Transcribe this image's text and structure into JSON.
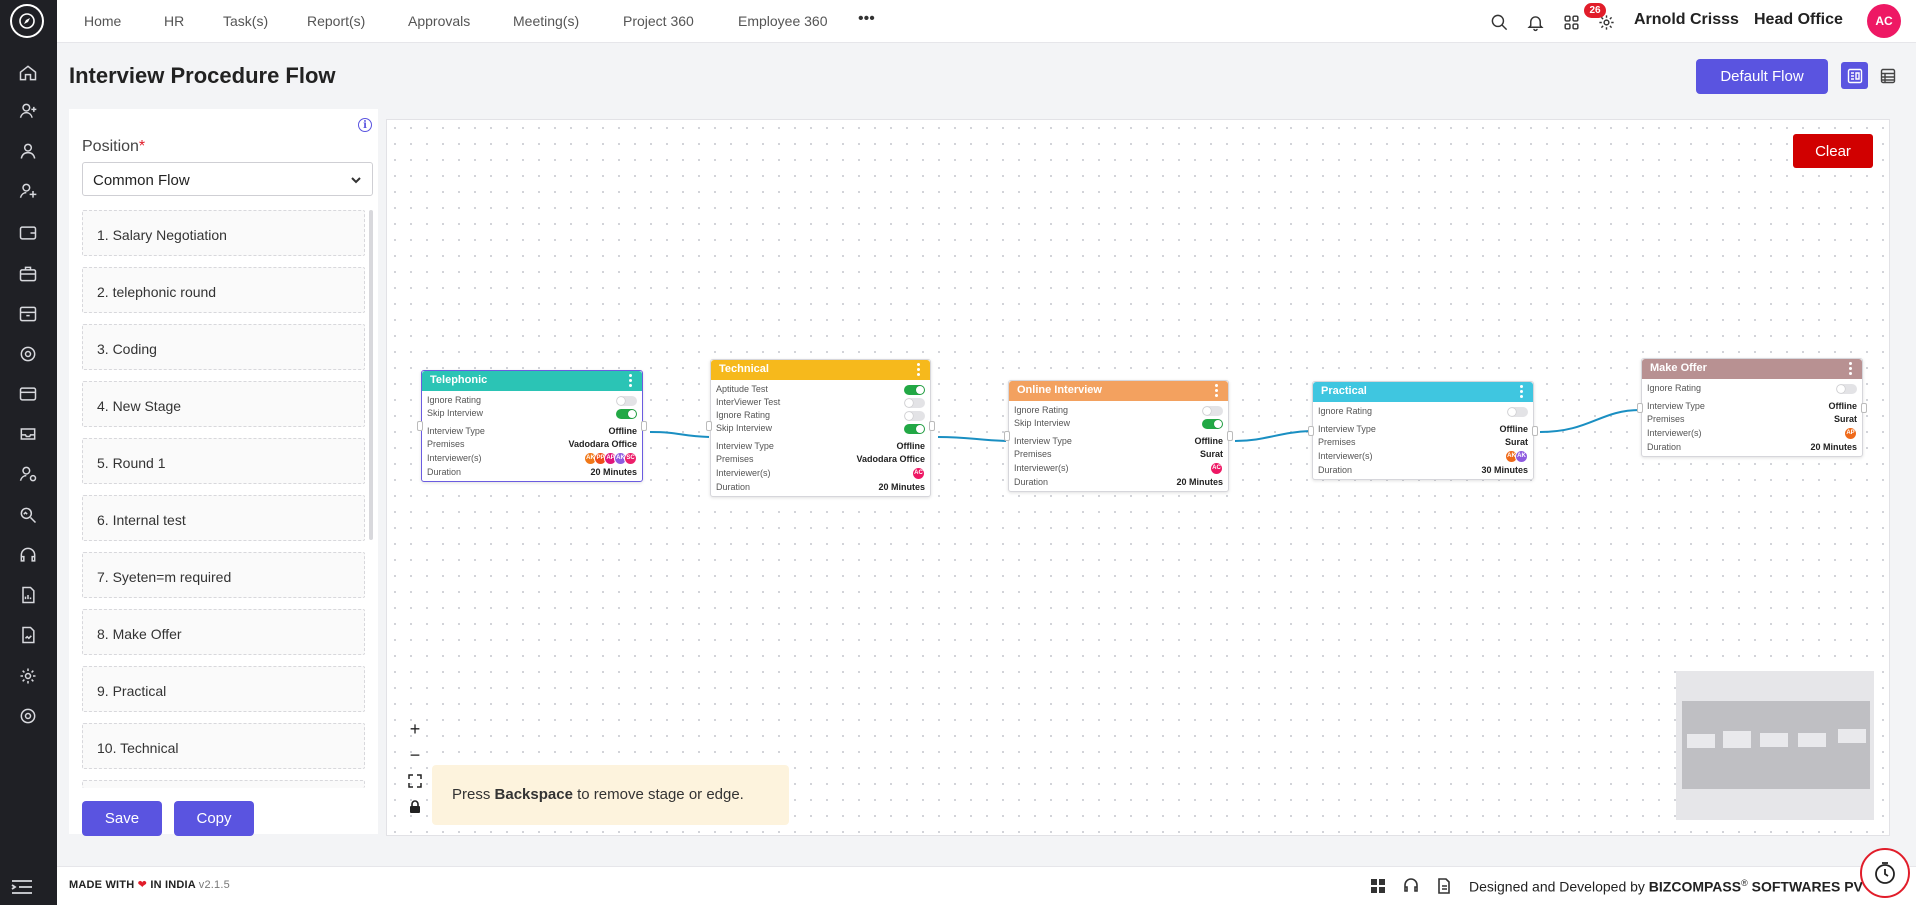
{
  "nav": {
    "items": [
      "Home",
      "HR",
      "Task(s)",
      "Report(s)",
      "Approvals",
      "Meeting(s)",
      "Project 360",
      "Employee 360"
    ],
    "more": "•••",
    "notification_count": "26",
    "user_name": "Arnold Crisss",
    "office": "Head Office",
    "avatar_initials": "AC"
  },
  "page": {
    "title": "Interview Procedure Flow",
    "default_flow_label": "Default Flow"
  },
  "left_panel": {
    "position_label": "Position",
    "required_mark": "*",
    "position_value": "Common Flow",
    "stages": [
      "1. Salary Negotiation",
      "2. telephonic round",
      "3. Coding",
      "4. New Stage",
      "5. Round 1",
      "6. Internal test",
      "7. Syeten=m required",
      "8. Make Offer",
      "9. Practical",
      "10. Technical"
    ],
    "save_label": "Save",
    "copy_label": "Copy"
  },
  "canvas": {
    "clear_label": "Clear",
    "hint_prefix": "Press ",
    "hint_key": "Backspace",
    "hint_suffix": " to remove stage or edge.",
    "nodes": [
      {
        "title": "Telephonic",
        "color": "#2bc4b5",
        "toggles": [
          {
            "label": "Ignore Rating",
            "on": false
          },
          {
            "label": "Skip Interview",
            "on": true
          }
        ],
        "interview_type_label": "Interview Type",
        "interview_type": "Offline",
        "premises_label": "Premises",
        "premises": "Vadodara Office",
        "interviewers_label": "Interviewer(s)",
        "interviewers": [
          {
            "i": "AK",
            "c": "#f07818"
          },
          {
            "i": "PP",
            "c": "#ef4e1a"
          },
          {
            "i": "AP",
            "c": "#e1157b"
          },
          {
            "i": "AK",
            "c": "#8e5ae0"
          },
          {
            "i": "SC",
            "c": "#ec1f6a"
          }
        ],
        "duration_label": "Duration",
        "duration": "20 Minutes"
      },
      {
        "title": "Technical",
        "color": "#f6b91c",
        "toggles": [
          {
            "label": "Aptitude Test",
            "on": true
          },
          {
            "label": "InterViewer Test",
            "on": false
          },
          {
            "label": "Ignore Rating",
            "on": false
          },
          {
            "label": "Skip Interview",
            "on": true
          }
        ],
        "interview_type_label": "Interview Type",
        "interview_type": "Offline",
        "premises_label": "Premises",
        "premises": "Vadodara Office",
        "interviewers_label": "Interviewer(s)",
        "interviewers": [
          {
            "i": "AC",
            "c": "#ee1864"
          }
        ],
        "duration_label": "Duration",
        "duration": "20 Minutes"
      },
      {
        "title": "Online Interview",
        "color": "#f3a15f",
        "toggles": [
          {
            "label": "Ignore Rating",
            "on": false
          },
          {
            "label": "Skip Interview",
            "on": true
          }
        ],
        "interview_type_label": "Interview Type",
        "interview_type": "Offline",
        "premises_label": "Premises",
        "premises": "Surat",
        "interviewers_label": "Interviewer(s)",
        "interviewers": [
          {
            "i": "AC",
            "c": "#ee1864"
          }
        ],
        "duration_label": "Duration",
        "duration": "20 Minutes"
      },
      {
        "title": "Practical",
        "color": "#3fc6e0",
        "toggles": [
          {
            "label": "Ignore Rating",
            "on": false
          }
        ],
        "interview_type_label": "Interview Type",
        "interview_type": "Offline",
        "premises_label": "Premises",
        "premises": "Surat",
        "interviewers_label": "Interviewer(s)",
        "interviewers": [
          {
            "i": "AK",
            "c": "#ef6a1a"
          },
          {
            "i": "AK",
            "c": "#8e5ae0"
          }
        ],
        "duration_label": "Duration",
        "duration": "30 Minutes"
      },
      {
        "title": "Make Offer",
        "color": "#b89192",
        "toggles": [
          {
            "label": "Ignore Rating",
            "on": false
          }
        ],
        "interview_type_label": "Interview Type",
        "interview_type": "Offline",
        "premises_label": "Premises",
        "premises": "Surat",
        "interviewers_label": "Interviewer(s)",
        "interviewers": [
          {
            "i": "AP",
            "c": "#ef6a1a"
          }
        ],
        "duration_label": "Duration",
        "duration": "20 Minutes"
      }
    ]
  },
  "footer": {
    "made_with": "MADE WITH",
    "in_india": "IN INDIA",
    "version": "v2.1.5",
    "designed_by": "Designed and Developed by",
    "brand": "BIZCOMPASS",
    "reg": "®",
    "company_suffix": " SOFTWARES PV"
  }
}
